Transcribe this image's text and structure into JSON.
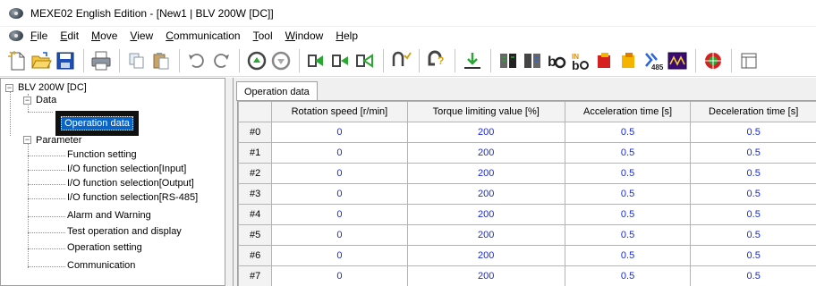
{
  "window": {
    "title": "MEXE02 English Edition - [New1 | BLV 200W [DC]]"
  },
  "menu": {
    "items": [
      {
        "label": "File",
        "mnemonic": "F",
        "rest": "ile"
      },
      {
        "label": "Edit",
        "mnemonic": "E",
        "rest": "dit"
      },
      {
        "label": "Move",
        "mnemonic": "M",
        "rest": "ove"
      },
      {
        "label": "View",
        "mnemonic": "V",
        "rest": "iew"
      },
      {
        "label": "Communication",
        "mnemonic": "C",
        "rest": "ommunication"
      },
      {
        "label": "Tool",
        "mnemonic": "T",
        "rest": "ool"
      },
      {
        "label": "Window",
        "mnemonic": "W",
        "rest": "indow"
      },
      {
        "label": "Help",
        "mnemonic": "H",
        "rest": "elp"
      }
    ]
  },
  "toolbar": {
    "icons": [
      "new-file-icon",
      "open-folder-icon",
      "save-icon",
      "print-icon",
      "copy-icon",
      "paste-icon",
      "undo-icon",
      "redo-icon",
      "upload-icon",
      "download-icon",
      "verify-icon",
      "compare-icon",
      "teach-icon",
      "alarm-icon",
      "monitor-icon",
      "waveform-icon"
    ],
    "labels": {
      "io_in": "IN",
      "rs485": "485"
    }
  },
  "tree": {
    "root": "BLV 200W [DC]",
    "data_group": "Data",
    "selected": "Operation data",
    "parameter_group": "Parameter",
    "parameter_items": [
      "Function setting",
      "I/O function selection[Input]",
      "I/O function selection[Output]",
      "I/O function selection[RS-485]",
      "Alarm and Warning",
      "Test operation and display",
      "Operation setting",
      "Communication"
    ]
  },
  "panel": {
    "tab": "Operation data",
    "columns": [
      "Rotation speed [r/min]",
      "Torque limiting value [%]",
      "Acceleration time [s]",
      "Deceleration time [s]"
    ],
    "rows": [
      {
        "label": "#0",
        "cells": [
          "0",
          "200",
          "0.5",
          "0.5"
        ]
      },
      {
        "label": "#1",
        "cells": [
          "0",
          "200",
          "0.5",
          "0.5"
        ]
      },
      {
        "label": "#2",
        "cells": [
          "0",
          "200",
          "0.5",
          "0.5"
        ]
      },
      {
        "label": "#3",
        "cells": [
          "0",
          "200",
          "0.5",
          "0.5"
        ]
      },
      {
        "label": "#4",
        "cells": [
          "0",
          "200",
          "0.5",
          "0.5"
        ]
      },
      {
        "label": "#5",
        "cells": [
          "0",
          "200",
          "0.5",
          "0.5"
        ]
      },
      {
        "label": "#6",
        "cells": [
          "0",
          "200",
          "0.5",
          "0.5"
        ]
      },
      {
        "label": "#7",
        "cells": [
          "0",
          "200",
          "0.5",
          "0.5"
        ]
      }
    ]
  },
  "colors": {
    "value_text": "#1a2bd6",
    "selection": "#0a64c8"
  }
}
